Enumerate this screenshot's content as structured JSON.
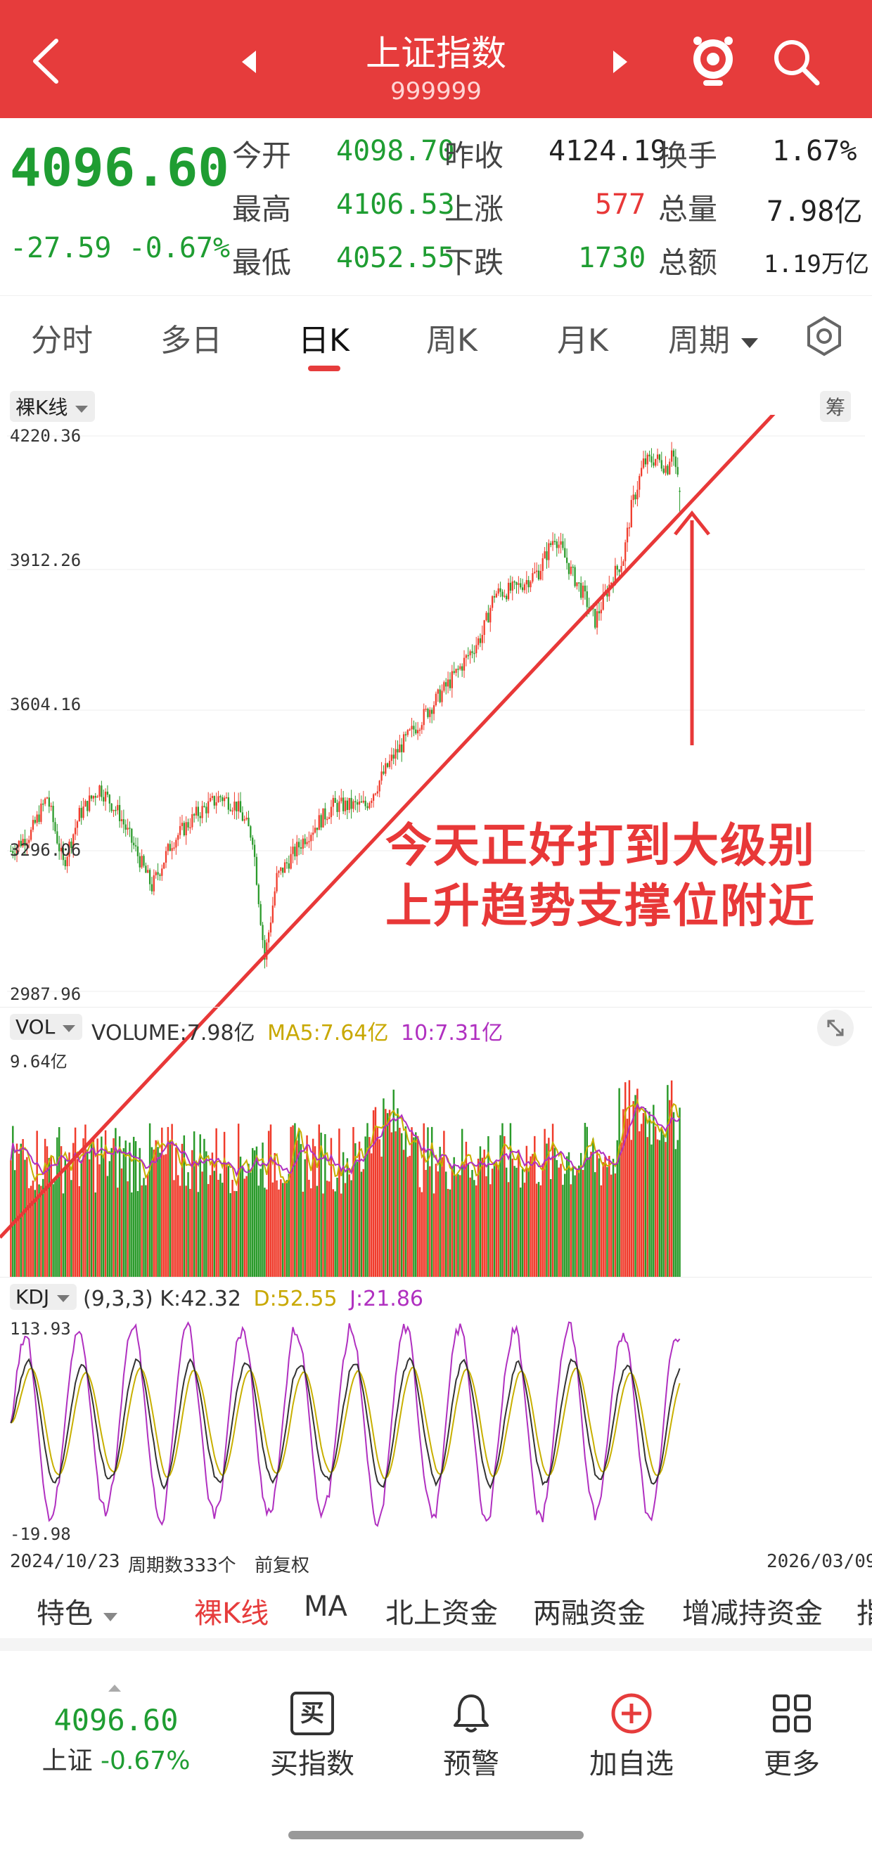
{
  "header": {
    "title": "上证指数",
    "code": "999999"
  },
  "quote": {
    "price": "4096.60",
    "change": "-27.59",
    "change_pct": "-0.67%",
    "open_label": "今开",
    "open": "4098.70",
    "prev_close_label": "昨收",
    "prev_close": "4124.19",
    "turnover_label": "换手",
    "turnover": "1.67%",
    "high_label": "最高",
    "high": "4106.53",
    "up_label": "上涨",
    "up": "577",
    "volume_label": "总量",
    "volume": "7.98亿",
    "low_label": "最低",
    "low": "4052.55",
    "down_label": "下跌",
    "down": "1730",
    "amount_label": "总额",
    "amount": "1.19万亿"
  },
  "tabs": {
    "items": [
      "分时",
      "多日",
      "日K",
      "周K",
      "月K",
      "周期"
    ],
    "active": "日K"
  },
  "chart_header": {
    "kline_mode": "裸K线",
    "fq_btn": "筹"
  },
  "annotation": {
    "line1": "今天正好打到大级别",
    "line2": "上升趋势支撑位附近"
  },
  "volume_header": {
    "label": "VOL",
    "volume_text": "VOLUME:7.98亿",
    "ma5_text": "MA5:7.64亿",
    "ma10_text": "10:7.31亿",
    "top_label": "9.64亿"
  },
  "kdj_header": {
    "label": "KDJ",
    "params": "(9,3,3)",
    "k_text": "K:42.32",
    "d_text": "D:52.55",
    "j_text": "J:21.86"
  },
  "footer_axis": {
    "start_date": "2024/10/23",
    "period_count": "周期数333个",
    "adjust": "前复权",
    "end_date": "2026/03/09"
  },
  "indicator_tabs": [
    "特色",
    "裸K线",
    "MA",
    "北上资金",
    "两融资金",
    "增减持资金",
    "指"
  ],
  "bottom_nav": {
    "price": "4096.60",
    "index_name": "上证",
    "change_pct": "-0.67%",
    "buy_label": "买指数",
    "buy_icon_char": "买",
    "alert_label": "预警",
    "add_label": "加自选",
    "more_label": "更多"
  },
  "colors": {
    "brand_red": "#e63c3c",
    "up_red": "#f03b2b",
    "down_green": "#2a9a2a",
    "k_line": "#333333",
    "d_line": "#c8b000",
    "j_line": "#b030c0"
  },
  "chart_data": {
    "type": "candlestick",
    "y_ticks": [
      "4220.36",
      "3912.26",
      "3604.16",
      "3296.06",
      "2987.96"
    ],
    "ylim": [
      2987.96,
      4220.36
    ],
    "last": {
      "open": 4098.7,
      "high": 4106.53,
      "low": 4052.55,
      "close": 4096.6
    },
    "trend_line": [
      [
        0,
        2900
      ],
      [
        1,
        4480
      ]
    ],
    "volume_ylim": [
      0,
      9.64
    ],
    "kdj_ylim": [
      -19.98,
      113.93
    ],
    "kdj_ticks": [
      "113.93",
      "-19.98"
    ]
  }
}
